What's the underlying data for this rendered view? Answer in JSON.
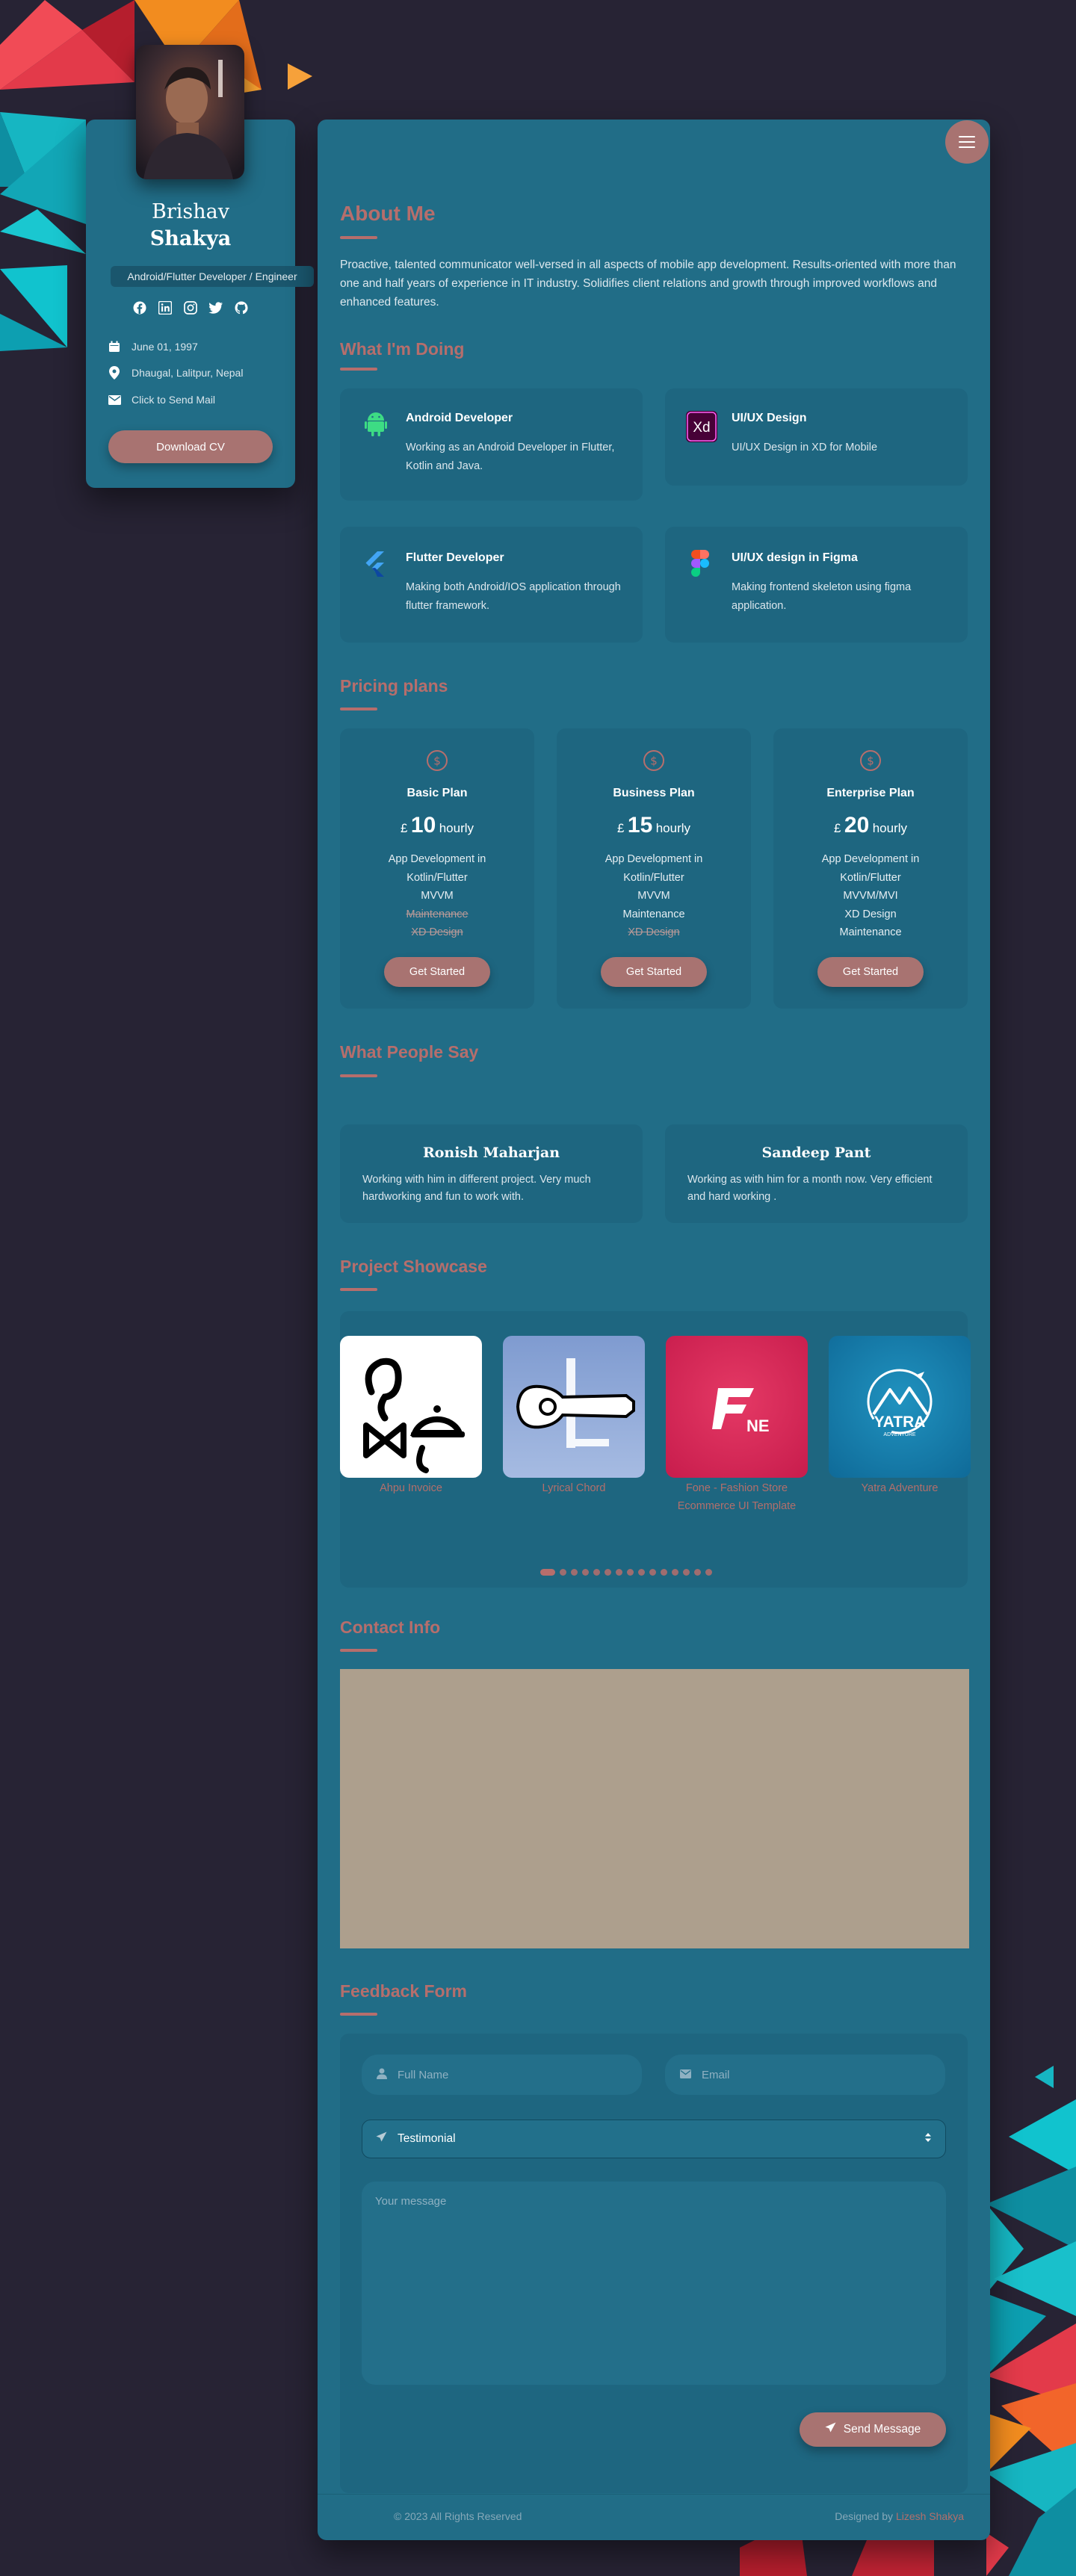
{
  "profile": {
    "first_name": "Brishav",
    "last_name": "Shakya",
    "role": "Android/Flutter Developer / Engineer",
    "birthday": "June 01, 1997",
    "location": "Dhaugal, Lalitpur, Nepal",
    "mail_label": "Click to Send Mail",
    "download_cv": "Download CV",
    "socials": [
      "facebook-icon",
      "linkedin-icon",
      "instagram-icon",
      "twitter-icon",
      "github-icon"
    ]
  },
  "about": {
    "title": "About Me",
    "text": "Proactive, talented communicator well-versed in all aspects of mobile app development. Results-oriented with more than one and half years of experience in IT industry. Solidifies client relations and growth through improved workflows and enhanced features."
  },
  "services": {
    "title": "What I'm Doing",
    "items": [
      {
        "title": "Android Developer",
        "desc": "Working as an Android Developer in Flutter, Kotlin and Java."
      },
      {
        "title": "UI/UX Design",
        "desc": "UI/UX Design in XD for Mobile"
      },
      {
        "title": "Flutter Developer",
        "desc": "Making both Android/IOS application through flutter framework."
      },
      {
        "title": "UI/UX design in Figma",
        "desc": "Making frontend skeleton using figma application."
      }
    ]
  },
  "pricing": {
    "title": "Pricing plans",
    "currency": "£",
    "per": "hourly",
    "button": "Get Started",
    "plans": [
      {
        "name": "Basic Plan",
        "amount": "10",
        "features": [
          "App Development in",
          "Kotlin/Flutter",
          "MVVM"
        ],
        "excluded": [
          "Maintenance",
          "XD Design"
        ]
      },
      {
        "name": "Business Plan",
        "amount": "15",
        "features": [
          "App Development in",
          "Kotlin/Flutter",
          "MVVM",
          "Maintenance"
        ],
        "excluded": [
          "XD Design"
        ]
      },
      {
        "name": "Enterprise Plan",
        "amount": "20",
        "features": [
          "App Development in",
          "Kotlin/Flutter",
          "MVVM/MVI",
          "XD Design",
          "Maintenance"
        ],
        "excluded": []
      }
    ]
  },
  "testimonials": {
    "title": "What People Say",
    "items": [
      {
        "name": "Ronish Maharjan",
        "text": "Working with him in different project. Very much hardworking and fun to work with."
      },
      {
        "name": "Sandeep Pant",
        "text": "Working as with him for a month now. Very efficient and hard working ."
      }
    ]
  },
  "projects": {
    "title": "Project Showcase",
    "items": [
      {
        "caption": "Ahpu Invoice"
      },
      {
        "caption": "Lyrical Chord"
      },
      {
        "caption": "Fone - Fashion Store Ecommerce UI Template"
      },
      {
        "caption": "Yatra Adventure"
      }
    ],
    "yatra_logo_text": "YATRA",
    "yatra_logo_sub": "ADVENTURE",
    "fone_logo_text": "NE",
    "dot_count": 15
  },
  "contact": {
    "title": "Contact Info"
  },
  "feedback": {
    "title": "Feedback Form",
    "name_placeholder": "Full Name",
    "email_placeholder": "Email",
    "type_selected": "Testimonial",
    "message_placeholder": "Your message",
    "send_label": "Send Message"
  },
  "footer": {
    "copyright": "© 2023 All Rights Reserved",
    "designed_by": "Designed by",
    "designer": "Lizesh Shakya"
  },
  "colors": {
    "background": "#272334",
    "card": "#216d87",
    "accent": "#b66e6c",
    "button": "#a87371"
  }
}
